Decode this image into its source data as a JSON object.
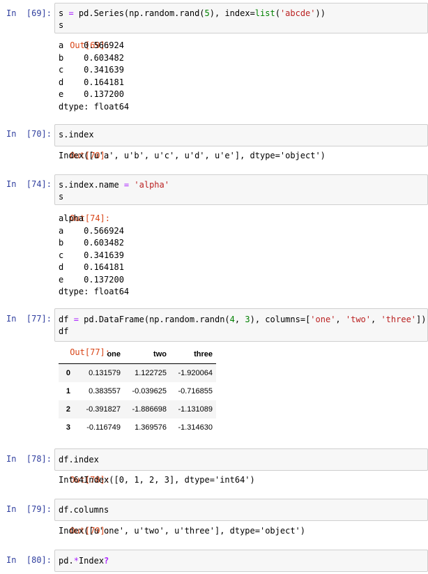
{
  "cells": [
    {
      "in_prompt": "In  [69]:",
      "code_line1": {
        "a": "s ",
        "b": "=",
        "c": " pd.Series(np.random.rand(",
        "d": "5",
        "e": "), index=",
        "f": "list",
        "g": "(",
        "h": "'abcde'",
        "i": "))"
      },
      "code_line2": "s",
      "out_prompt": "Out[69]:",
      "output": "a    0.566924\nb    0.603482\nc    0.341639\nd    0.164181\ne    0.137200\ndtype: float64"
    },
    {
      "in_prompt": "In  [70]:",
      "code_line1": "s.index",
      "out_prompt": "Out[70]:",
      "output": "Index([u'a', u'b', u'c', u'd', u'e'], dtype='object')"
    },
    {
      "in_prompt": "In  [74]:",
      "code_line1": {
        "a": "s.index.name ",
        "b": "=",
        "c": " ",
        "d": "'alpha'"
      },
      "code_line2": "s",
      "out_prompt": "Out[74]:",
      "output": "alpha\na    0.566924\nb    0.603482\nc    0.341639\nd    0.164181\ne    0.137200\ndtype: float64"
    },
    {
      "in_prompt": "In  [77]:",
      "code_line1": {
        "a": "df ",
        "b": "=",
        "c": " pd.DataFrame(np.random.randn(",
        "d": "4",
        "e": ", ",
        "f": "3",
        "g": "), columns=[",
        "h": "'one'",
        "i": ", ",
        "j": "'two'",
        "k": ", ",
        "l": "'three'",
        "m": "])"
      },
      "code_line2": "df",
      "out_prompt": "Out[77]:",
      "table": {
        "columns": [
          "",
          "one",
          "two",
          "three"
        ],
        "rows": [
          [
            "0",
            "0.131579",
            "1.122725",
            "-1.920064"
          ],
          [
            "1",
            "0.383557",
            "-0.039625",
            "-0.716855"
          ],
          [
            "2",
            "-0.391827",
            "-1.886698",
            "-1.131089"
          ],
          [
            "3",
            "-0.116749",
            "1.369576",
            "-1.314630"
          ]
        ]
      }
    },
    {
      "in_prompt": "In  [78]:",
      "code_line1": "df.index",
      "out_prompt": "Out[78]:",
      "output": "Int64Index([0, 1, 2, 3], dtype='int64')"
    },
    {
      "in_prompt": "In  [79]:",
      "code_line1": "df.columns",
      "out_prompt": "Out[79]:",
      "output": "Index([u'one', u'two', u'three'], dtype='object')"
    },
    {
      "in_prompt": "In  [80]:",
      "code_line1": {
        "a": "pd.",
        "b": "*",
        "c": "Index",
        "d": "?"
      }
    }
  ],
  "colors": {
    "in_prompt": "#303F9F",
    "out_prompt": "#D84315",
    "input_bg": "#f7f7f7",
    "input_border": "#cfcfcf",
    "keyword": "#008000",
    "operator": "#AA22FF",
    "string": "#BA2121"
  }
}
